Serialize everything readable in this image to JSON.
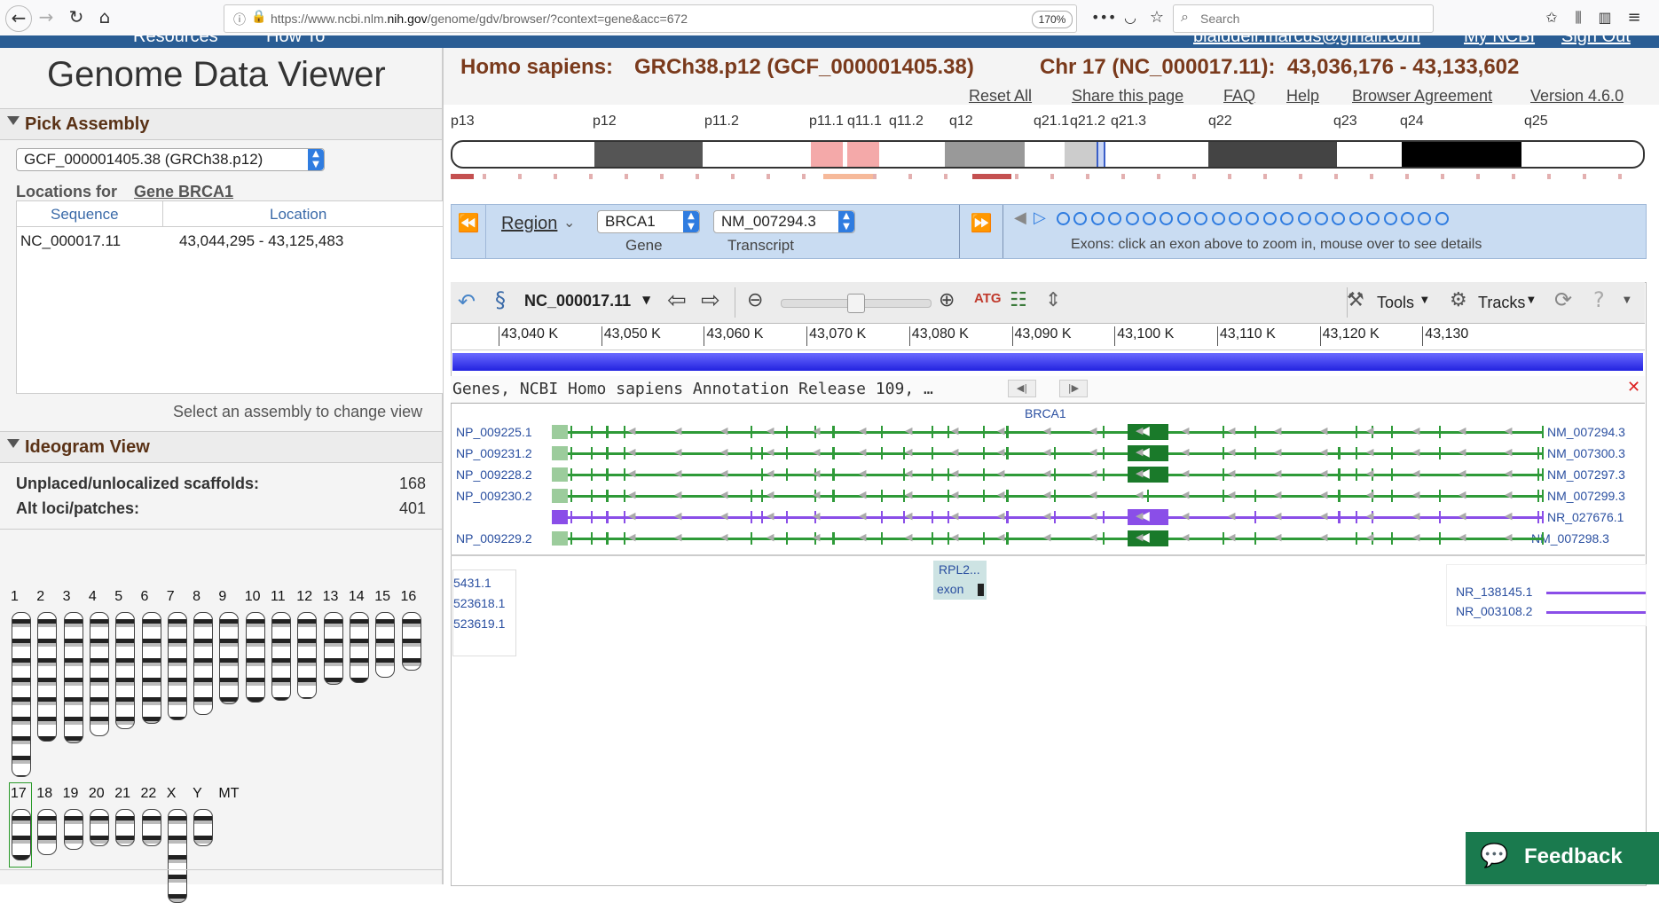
{
  "browser": {
    "url": "https://www.ncbi.nlm.nih.gov/genome/gdv/browser/?context=gene&acc=672",
    "url_prefix": "https://www.ncbi.nlm.",
    "url_host": "nih.gov",
    "url_rest": "/genome/gdv/browser/?context=gene&acc=672",
    "zoom": "170%",
    "search_placeholder": "Search"
  },
  "ncbi_header": {
    "resources": "Resources",
    "how_to": "How To",
    "email": "biaiddeii.marcus@gmail.com",
    "my_ncbi": "My NCBI",
    "sign_out": "Sign Out"
  },
  "app": {
    "title": "Genome Data Viewer",
    "organism": "Homo sapiens:",
    "assembly": "GRCh38.p12 (GCF_000001405.38)",
    "location": "Chr 17 (NC_000017.11):  43,036,176 - 43,133,602",
    "top_links": [
      "Reset All",
      "Share this page",
      "FAQ",
      "Help",
      "Browser Agreement",
      "Version 4.6.0"
    ]
  },
  "pick_assembly": {
    "header": "Pick Assembly",
    "selected": "GCF_000001405.38 (GRCh38.p12)",
    "locations_for": "Locations for",
    "gene_link": "Gene BRCA1",
    "columns": [
      "Sequence",
      "Location"
    ],
    "rows": [
      [
        "NC_000017.11",
        "43,044,295 - 43,125,483"
      ]
    ],
    "hint": "Select an assembly to change view"
  },
  "ideogram": {
    "header": "Ideogram View",
    "unplaced_label": "Unplaced/unlocalized scaffolds:",
    "unplaced_value": "168",
    "alt_label": "Alt loci/patches:",
    "alt_value": "401",
    "chromosomes_row1": [
      "1",
      "2",
      "3",
      "4",
      "5",
      "6",
      "7",
      "8",
      "9",
      "10",
      "11",
      "12",
      "13",
      "14",
      "15",
      "16"
    ],
    "chromosomes_row2": [
      "17",
      "18",
      "19",
      "20",
      "21",
      "22",
      "X",
      "Y",
      "MT"
    ],
    "selected": "17"
  },
  "bands": [
    "p13",
    "p12",
    "p11.2",
    "p11.1",
    "q11.1",
    "q11.2",
    "q12",
    "q21.1",
    "q21.2",
    "q21.3",
    "q22",
    "q23",
    "q24",
    "q25"
  ],
  "navigator": {
    "region_label": "Region",
    "gene_value": "BRCA1",
    "gene_caption": "Gene",
    "transcript_value": "NM_007294.3",
    "transcript_caption": "Transcript",
    "exon_count": 23,
    "exon_hint": "Exons: click an exon above to zoom in, mouse over to see details"
  },
  "viewer": {
    "sequence": "NC_000017.11",
    "tools_label": "Tools",
    "tracks_label": "Tracks",
    "ruler_ticks": [
      "43,040 K",
      "43,050 K",
      "43,060 K",
      "43,070 K",
      "43,080 K",
      "43,090 K",
      "43,100 K",
      "43,110 K",
      "43,120 K",
      "43,130"
    ],
    "track_title": "Genes, NCBI Homo sapiens Annotation Release 109, …",
    "gene_name": "BRCA1",
    "transcripts": [
      {
        "left": "NP_009225.1",
        "right": "NM_007294.3",
        "color": "#2e9a38"
      },
      {
        "left": "NP_009231.2",
        "right": "NM_007300.3",
        "color": "#2e9a38"
      },
      {
        "left": "NP_009228.2",
        "right": "NM_007297.3",
        "color": "#2e9a38"
      },
      {
        "left": "NP_009230.2",
        "right": "NM_007299.3",
        "color": "#2e9a38"
      },
      {
        "left": "",
        "right": "NR_027676.1",
        "color": "#8a4ee8"
      },
      {
        "left": "NP_009229.2",
        "right": "NM_007298.3",
        "color": "#2e9a38"
      }
    ],
    "rpl_label": "RPL2...",
    "rpl_exon": "exon",
    "partial_left": [
      "5431.1",
      "523618.1",
      "523619.1"
    ],
    "nr_right": [
      "NR_138145.1",
      "NR_003108.2"
    ]
  },
  "feedback": "Feedback",
  "colors": {
    "brand": "#2a5d94",
    "title_brown": "#7a3a1c",
    "nav_blue": "#c9dcf2",
    "feedback": "#1a7a4e"
  }
}
